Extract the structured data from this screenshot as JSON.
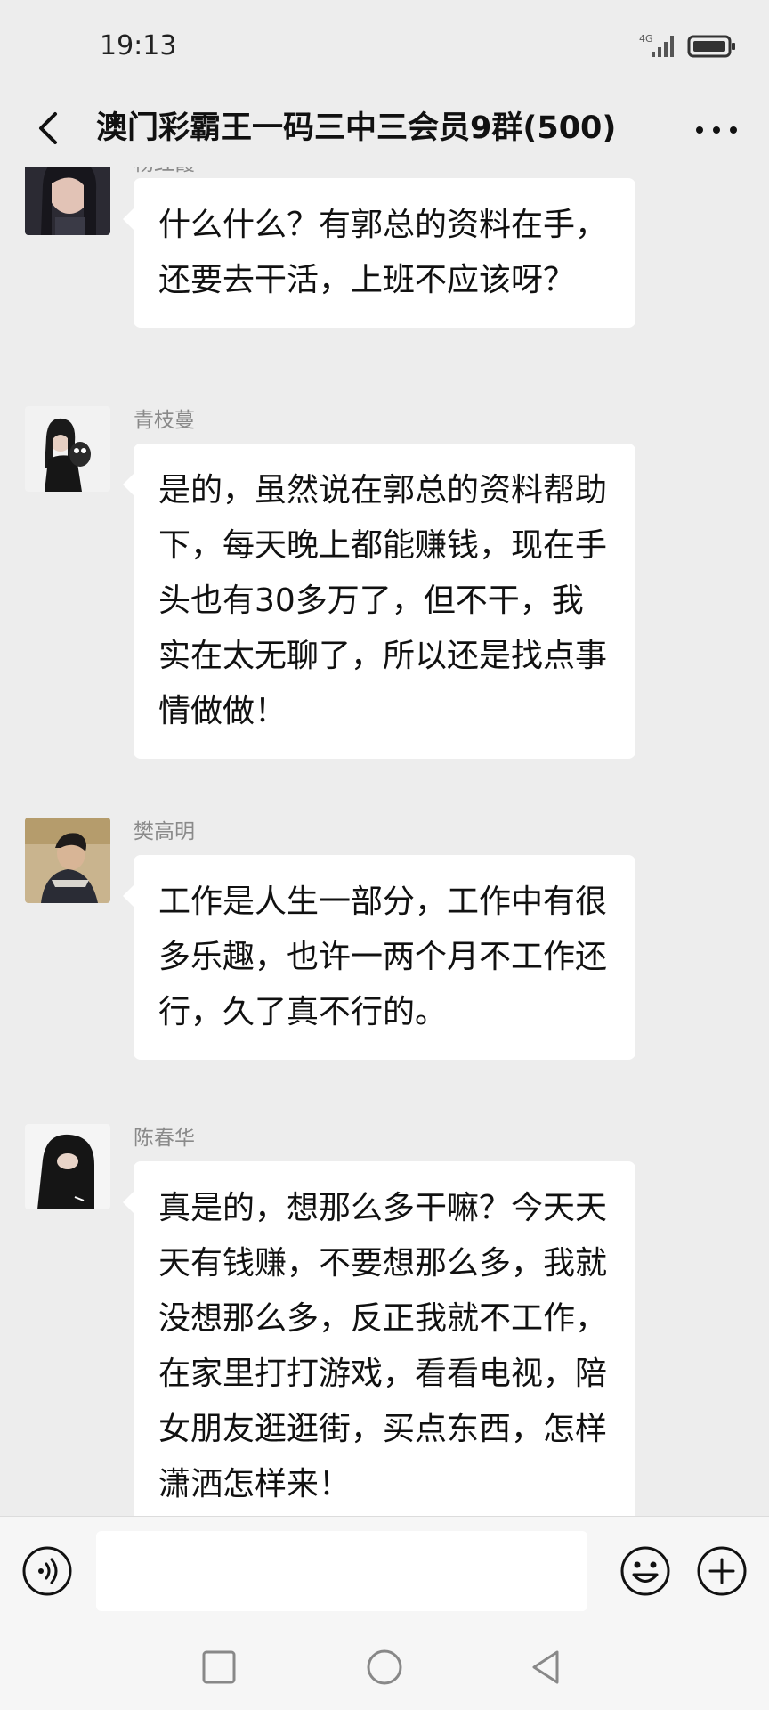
{
  "status_bar": {
    "time": "19:13",
    "network": "4G",
    "icons": [
      "signal-icon",
      "battery-icon"
    ]
  },
  "header": {
    "title": "澳门彩霸王一码三中三会员9群(500)",
    "back_icon": "chevron-left-icon",
    "more_icon": "more-icon"
  },
  "messages": [
    {
      "sender": "杨红霞",
      "text": "什么什么？有郭总的资料在手，还要去干活，上班不应该呀？"
    },
    {
      "sender": "青枝蔓",
      "text": "是的，虽然说在郭总的资料帮助下，每天晚上都能赚钱，现在手头也有30多万了，但不干，我实在太无聊了，所以还是找点事情做做！"
    },
    {
      "sender": "樊高明",
      "text": "工作是人生一部分，工作中有很多乐趣，也许一两个月不工作还行，久了真不行的。"
    },
    {
      "sender": "陈春华",
      "text": "真是的，想那么多干嘛？今天天天有钱赚，不要想那么多，我就没想那么多，反正我就不工作，在家里打打游戏，看看电视，陪女朋友逛逛街，买点东西，怎样潇洒怎样来！"
    }
  ],
  "input_bar": {
    "value": "",
    "icons": [
      "voice-icon",
      "emoji-icon",
      "plus-icon"
    ]
  },
  "system_nav": {
    "icons": [
      "recent-apps-icon",
      "home-icon",
      "back-triangle-icon"
    ]
  },
  "colors": {
    "background": "#ededed",
    "bubble": "#ffffff",
    "sender_name": "#8a8a8a"
  }
}
